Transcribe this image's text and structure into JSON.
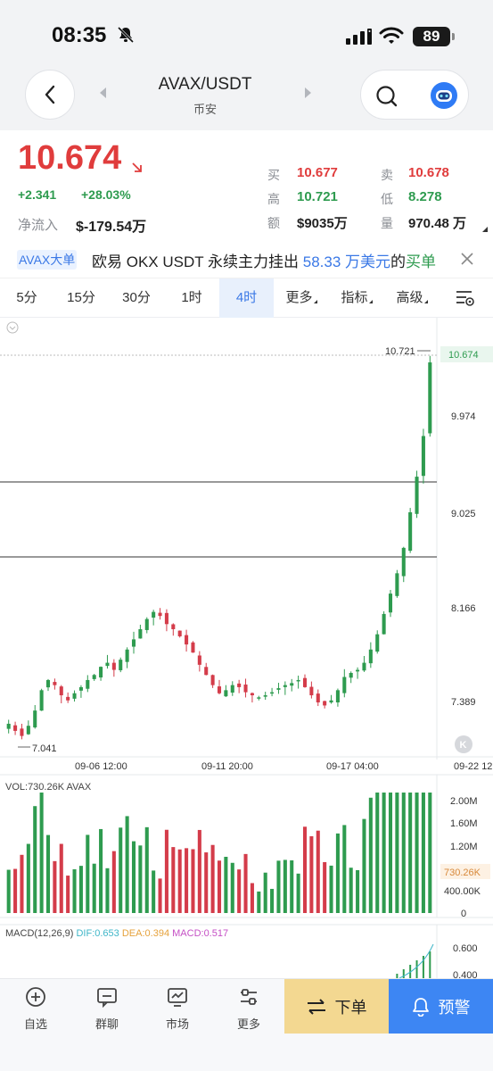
{
  "status_bar": {
    "time": "08:35",
    "battery": "89"
  },
  "header": {
    "pair": "AVAX/USDT",
    "exchange": "币安"
  },
  "quote": {
    "price": "10.674",
    "change_abs": "+2.341",
    "change_pct": "+28.03%",
    "inflow_label": "净流入",
    "inflow_value": "$-179.54万",
    "stats": [
      {
        "label": "买",
        "value": "10.677",
        "color": "red"
      },
      {
        "label": "卖",
        "value": "10.678",
        "color": "red"
      },
      {
        "label": "高",
        "value": "10.721",
        "color": "green"
      },
      {
        "label": "低",
        "value": "8.278",
        "color": "green"
      },
      {
        "label": "额",
        "value": "$9035万",
        "color": "dark"
      },
      {
        "label": "量",
        "value": "970.48 万",
        "color": "dark"
      }
    ]
  },
  "ticker": {
    "tag": "AVAX大单",
    "text_prefix": "欧易 OKX USDT 永续主力挂出 ",
    "amount": "58.33 万美元",
    "text_mid": "的",
    "side": "买单"
  },
  "tabs": [
    "5分",
    "15分",
    "30分",
    "1时",
    "4时",
    "更多",
    "指标",
    "高级"
  ],
  "active_tab": "4时",
  "chart_data": {
    "type": "candlestick",
    "price_axis_labels": [
      "9.974",
      "9.025",
      "8.166",
      "7.389"
    ],
    "high_label": "10.721",
    "low_label": "7.041",
    "current_price_label": "10.674",
    "date_labels": [
      "09-06 12:00",
      "09-11 20:00",
      "09-17 04:00",
      "09-22 12"
    ],
    "candles_close": [
      7.12,
      7.05,
      7.0,
      7.1,
      7.25,
      7.45,
      7.55,
      7.5,
      7.4,
      7.35,
      7.42,
      7.48,
      7.55,
      7.6,
      7.68,
      7.72,
      7.65,
      7.75,
      7.85,
      7.95,
      8.05,
      8.15,
      8.22,
      8.18,
      8.1,
      8.05,
      7.98,
      7.9,
      7.82,
      7.7,
      7.6,
      7.5,
      7.42,
      7.45,
      7.5,
      7.48,
      7.43,
      7.4,
      7.38,
      7.4,
      7.43,
      7.47,
      7.5,
      7.52,
      7.55,
      7.48,
      7.4,
      7.33,
      7.3,
      7.35,
      7.45,
      7.58,
      7.62,
      7.65,
      7.72,
      7.85,
      8.0,
      8.2,
      8.4,
      8.6,
      8.85,
      9.2,
      9.55,
      9.95,
      10.674
    ],
    "volume_axis_labels": [
      "2.00M",
      "1.60M",
      "1.20M",
      "730.26K",
      "400.00K",
      "0"
    ],
    "volume_title": "VOL:730.26K AVAX",
    "macd_axis_labels": [
      "0.600",
      "0.400"
    ],
    "macd": {
      "label": "MACD(12,26,9)",
      "dif": "DIF:0.653",
      "dea": "DEA:0.394",
      "macd": "MACD:0.517"
    },
    "colors": {
      "up": "#2e9b4f",
      "down": "#d43c4a"
    }
  },
  "bottom_nav": {
    "items": [
      "自选",
      "群聊",
      "市场",
      "更多"
    ],
    "order": "下单",
    "alert": "预警"
  }
}
